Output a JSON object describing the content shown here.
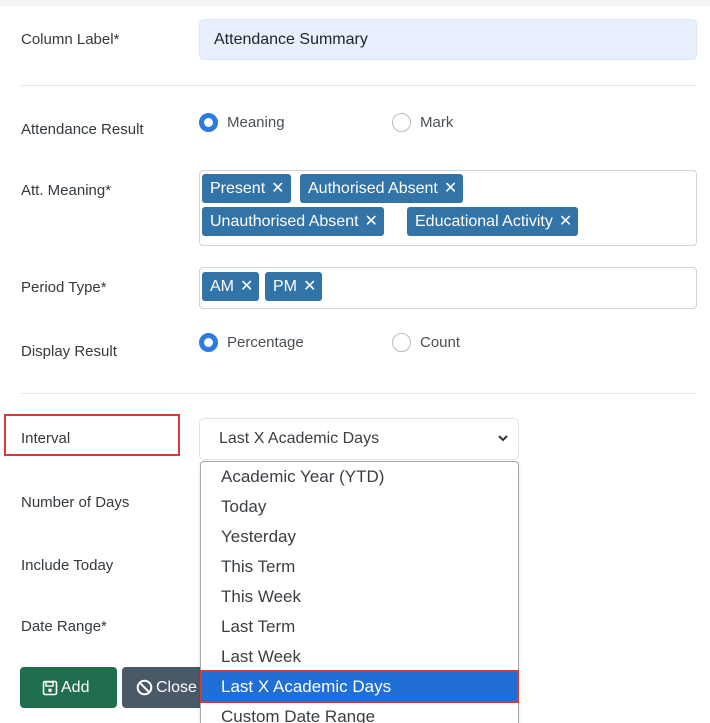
{
  "form": {
    "column_label": {
      "label": "Column Label*",
      "value": "Attendance Summary"
    },
    "attendance_result": {
      "label": "Attendance Result",
      "options": [
        {
          "label": "Meaning",
          "checked": true
        },
        {
          "label": "Mark",
          "checked": false
        }
      ]
    },
    "att_meaning": {
      "label": "Att. Meaning*",
      "tags": [
        "Present",
        "Authorised Absent",
        "Unauthorised Absent",
        "Educational Activity"
      ]
    },
    "period_type": {
      "label": "Period Type*",
      "tags": [
        "AM",
        "PM"
      ]
    },
    "display_result": {
      "label": "Display Result",
      "options": [
        {
          "label": "Percentage",
          "checked": true
        },
        {
          "label": "Count",
          "checked": false
        }
      ]
    },
    "interval": {
      "label": "Interval",
      "selected": "Last X Academic Days",
      "options": [
        "Academic Year (YTD)",
        "Today",
        "Yesterday",
        "This Term",
        "This Week",
        "Last Term",
        "Last Week",
        "Last X Academic Days",
        "Custom Date Range"
      ]
    },
    "number_of_days": {
      "label": "Number of Days"
    },
    "include_today": {
      "label": "Include Today"
    },
    "date_range": {
      "label": "Date Range*"
    }
  },
  "actions": {
    "add": "Add",
    "close": "Close"
  },
  "colors": {
    "tag": "#3273a8",
    "radio_checked": "#2c7be5",
    "highlight": "#d33a3a",
    "selected_option": "#1f6fd6",
    "add_button": "#1f6f4e",
    "close_button": "#4a5968"
  },
  "icons": {
    "tag_remove": "close-icon",
    "add": "save-icon",
    "close": "ban-icon",
    "select": "chevron-down-icon"
  }
}
